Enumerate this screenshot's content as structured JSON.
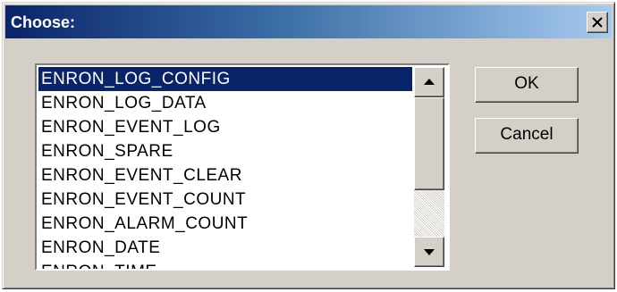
{
  "window": {
    "title": "Choose:",
    "close_icon": "close-icon"
  },
  "list": {
    "selected_index": 0,
    "items": [
      {
        "label": "ENRON_LOG_CONFIG"
      },
      {
        "label": "ENRON_LOG_DATA"
      },
      {
        "label": "ENRON_EVENT_LOG"
      },
      {
        "label": "ENRON_SPARE"
      },
      {
        "label": "ENRON_EVENT_CLEAR"
      },
      {
        "label": "ENRON_EVENT_COUNT"
      },
      {
        "label": "ENRON_ALARM_COUNT"
      },
      {
        "label": "ENRON_DATE"
      },
      {
        "label": "ENRON_TIME"
      }
    ]
  },
  "scrollbar": {
    "up_icon": "arrow-up-icon",
    "down_icon": "arrow-down-icon"
  },
  "buttons": {
    "ok_label": "OK",
    "cancel_label": "Cancel"
  },
  "colors": {
    "titlebar_start": "#0a246a",
    "titlebar_end": "#a6caf0",
    "selection": "#0a246a",
    "face": "#d4d0c8"
  }
}
